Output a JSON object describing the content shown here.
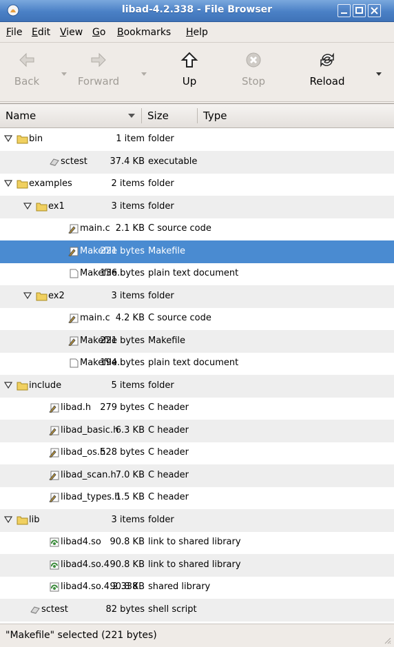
{
  "window": {
    "title": "libad-4.2.338 - File Browser"
  },
  "menu": [
    {
      "label": "File"
    },
    {
      "label": "Edit"
    },
    {
      "label": "View"
    },
    {
      "label": "Go"
    },
    {
      "label": "Bookmarks"
    },
    {
      "label": "Help"
    }
  ],
  "toolbar": {
    "back": {
      "label": "Back",
      "enabled": false,
      "icon": "back-arrow-icon"
    },
    "forward": {
      "label": "Forward",
      "enabled": false,
      "icon": "forward-arrow-icon"
    },
    "up": {
      "label": "Up",
      "enabled": true,
      "icon": "up-arrow-icon"
    },
    "stop": {
      "label": "Stop",
      "enabled": false,
      "icon": "stop-icon"
    },
    "reload": {
      "label": "Reload",
      "enabled": true,
      "icon": "reload-icon"
    }
  },
  "columns": {
    "name": "Name",
    "size": "Size",
    "type": "Type"
  },
  "rows": [
    {
      "name": "bin",
      "size": "1 item",
      "type": "folder",
      "depth": 0,
      "kind": "folder",
      "expanded": true
    },
    {
      "name": "sctest",
      "size": "37.4 KB",
      "type": "executable",
      "depth": 1,
      "kind": "exec"
    },
    {
      "name": "examples",
      "size": "2 items",
      "type": "folder",
      "depth": 0,
      "kind": "folder",
      "expanded": true
    },
    {
      "name": "ex1",
      "size": "3 items",
      "type": "folder",
      "depth": 1,
      "kind": "folder",
      "expanded": true
    },
    {
      "name": "main.c",
      "size": "2.1 KB",
      "type": "C source code",
      "depth": 2,
      "kind": "source"
    },
    {
      "name": "Makefile",
      "size": "221 bytes",
      "type": "Makefile",
      "depth": 2,
      "kind": "source",
      "selected": true
    },
    {
      "name": "Makefile.i",
      "size": "136 bytes",
      "type": "plain text document",
      "depth": 2,
      "kind": "text"
    },
    {
      "name": "ex2",
      "size": "3 items",
      "type": "folder",
      "depth": 1,
      "kind": "folder",
      "expanded": true
    },
    {
      "name": "main.c",
      "size": "4.2 KB",
      "type": "C source code",
      "depth": 2,
      "kind": "source"
    },
    {
      "name": "Makefile",
      "size": "221 bytes",
      "type": "Makefile",
      "depth": 2,
      "kind": "source"
    },
    {
      "name": "Makefile.i",
      "size": "194 bytes",
      "type": "plain text document",
      "depth": 2,
      "kind": "text"
    },
    {
      "name": "include",
      "size": "5 items",
      "type": "folder",
      "depth": 0,
      "kind": "folder",
      "expanded": true
    },
    {
      "name": "libad.h",
      "size": "279 bytes",
      "type": "C header",
      "depth": 1,
      "kind": "source"
    },
    {
      "name": "libad_basic.h",
      "size": "6.3 KB",
      "type": "C header",
      "depth": 1,
      "kind": "source"
    },
    {
      "name": "libad_os.h",
      "size": "528 bytes",
      "type": "C header",
      "depth": 1,
      "kind": "source"
    },
    {
      "name": "libad_scan.h",
      "size": "7.0 KB",
      "type": "C header",
      "depth": 1,
      "kind": "source"
    },
    {
      "name": "libad_types.h",
      "size": "1.5 KB",
      "type": "C header",
      "depth": 1,
      "kind": "source"
    },
    {
      "name": "lib",
      "size": "3 items",
      "type": "folder",
      "depth": 0,
      "kind": "folder",
      "expanded": true
    },
    {
      "name": "libad4.so",
      "size": "90.8 KB",
      "type": "link to shared library",
      "depth": 1,
      "kind": "lib"
    },
    {
      "name": "libad4.so.4",
      "size": "90.8 KB",
      "type": "link to shared library",
      "depth": 1,
      "kind": "lib"
    },
    {
      "name": "libad4.so.4.2.338",
      "size": "90.8 KB",
      "type": "shared library",
      "depth": 1,
      "kind": "lib"
    },
    {
      "name": "sctest",
      "size": "82 bytes",
      "type": "shell script",
      "depth": 0,
      "kind": "exec"
    }
  ],
  "status": {
    "text": "\"Makefile\" selected (221 bytes)"
  },
  "colors": {
    "title_bar": "#4a80c6",
    "selection": "#4a8bd1",
    "folder": "#f0d060",
    "window_bg": "#efebe7"
  }
}
